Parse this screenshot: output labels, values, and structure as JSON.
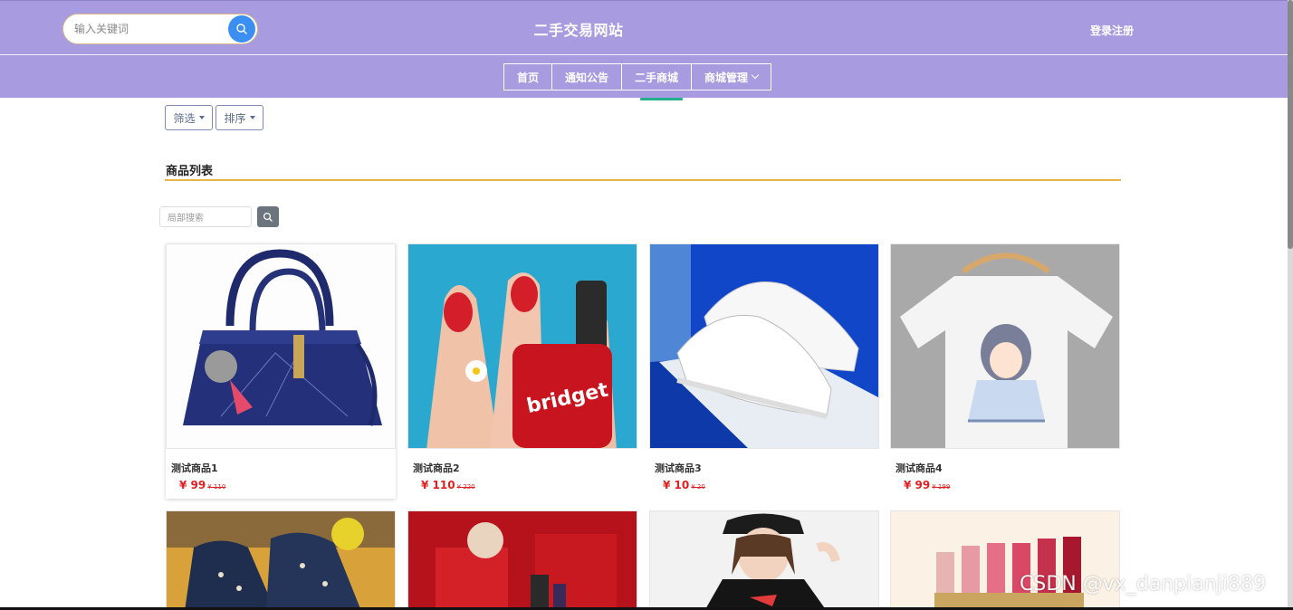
{
  "header": {
    "search_placeholder": "输入关键词",
    "site_title": "二手交易网站",
    "login_label": "登录注册",
    "bg_color": "#a99be0"
  },
  "nav": {
    "items": [
      {
        "label": "首页"
      },
      {
        "label": "通知公告"
      },
      {
        "label": "二手商城",
        "active": true
      },
      {
        "label": "商城管理",
        "has_dropdown": true
      }
    ]
  },
  "filters": {
    "filter_label": "筛选",
    "sort_label": "排序"
  },
  "section": {
    "title": "商品列表",
    "accent_color": "#e8b54a"
  },
  "local_search": {
    "placeholder": "局部搜索"
  },
  "products": [
    {
      "name": "测试商品1",
      "price": "¥ 99",
      "orig": "¥ 110",
      "image": "navy-handbag"
    },
    {
      "name": "测试商品2",
      "price": "¥ 110",
      "orig": "¥ 220",
      "image": "red-nail-polish"
    },
    {
      "name": "测试商品3",
      "price": "¥ 10",
      "orig": "¥ 20",
      "image": "white-sneakers"
    },
    {
      "name": "测试商品4",
      "price": "¥ 99",
      "orig": "¥ 199",
      "image": "printed-tshirt"
    },
    {
      "name": "",
      "price": "",
      "orig": "",
      "image": "denim-high-tops"
    },
    {
      "name": "",
      "price": "",
      "orig": "",
      "image": "red-gift-box"
    },
    {
      "name": "",
      "price": "",
      "orig": "",
      "image": "girl-in-cap"
    },
    {
      "name": "",
      "price": "",
      "orig": "",
      "image": "lipsticks"
    }
  ],
  "watermark": "CSDN @vx_danpianji889"
}
